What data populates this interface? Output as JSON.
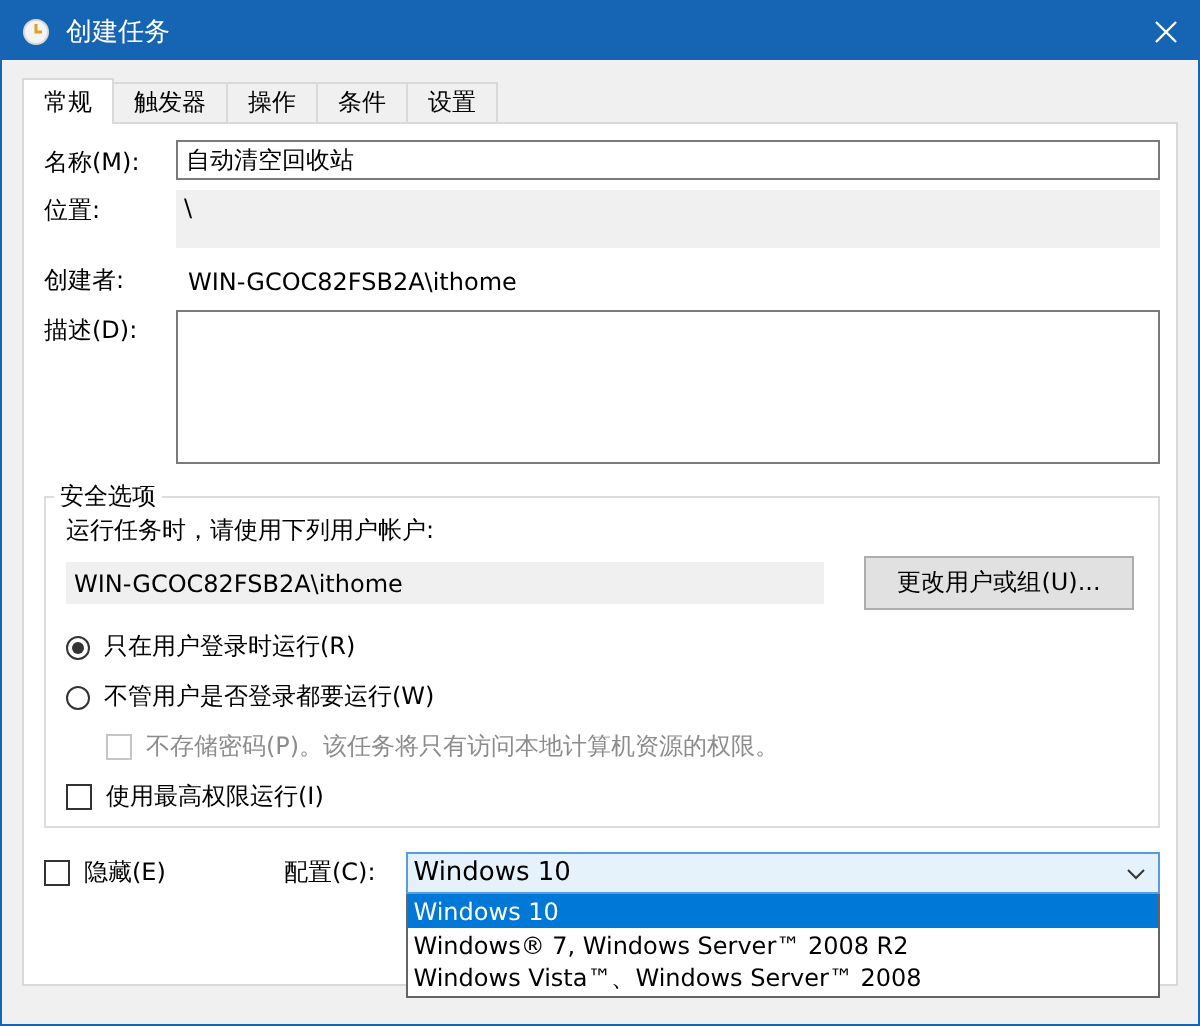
{
  "window": {
    "title": "创建任务"
  },
  "tabs": [
    {
      "label": "常规",
      "selected": true
    },
    {
      "label": "触发器",
      "selected": false
    },
    {
      "label": "操作",
      "selected": false
    },
    {
      "label": "条件",
      "selected": false
    },
    {
      "label": "设置",
      "selected": false
    }
  ],
  "general": {
    "name_label": "名称(M):",
    "name_value": "自动清空回收站",
    "location_label": "位置:",
    "location_value": "\\",
    "author_label": "创建者:",
    "author_value": "WIN-GCOC82FSB2A\\ithome",
    "description_label": "描述(D):"
  },
  "security": {
    "title": "安全选项",
    "account_prompt": "运行任务时，请使用下列用户帐户:",
    "account_value": "WIN-GCOC82FSB2A\\ithome",
    "change_button": "更改用户或组(U)...",
    "options": [
      {
        "kind": "radio",
        "label": "只在用户登录时运行(R)",
        "selected": true
      },
      {
        "kind": "radio",
        "label": "不管用户是否登录都要运行(W)",
        "selected": false
      },
      {
        "kind": "checkbox",
        "label": "不存储密码(P)。该任务将只有访问本地计算机资源的权限。",
        "checked": false,
        "disabled": true
      },
      {
        "kind": "checkbox",
        "label": "使用最高权限运行(I)",
        "checked": false,
        "disabled": false
      }
    ]
  },
  "hidden": {
    "label": "隐藏(E)",
    "checked": false
  },
  "configure": {
    "label": "配置(C):",
    "value": "Windows 10",
    "options": [
      {
        "label": "Windows 10",
        "selected": true
      },
      {
        "label": "Windows® 7, Windows Server™ 2008 R2",
        "selected": false
      },
      {
        "label": "Windows Vista™、Windows Server™ 2008",
        "selected": false
      }
    ]
  }
}
